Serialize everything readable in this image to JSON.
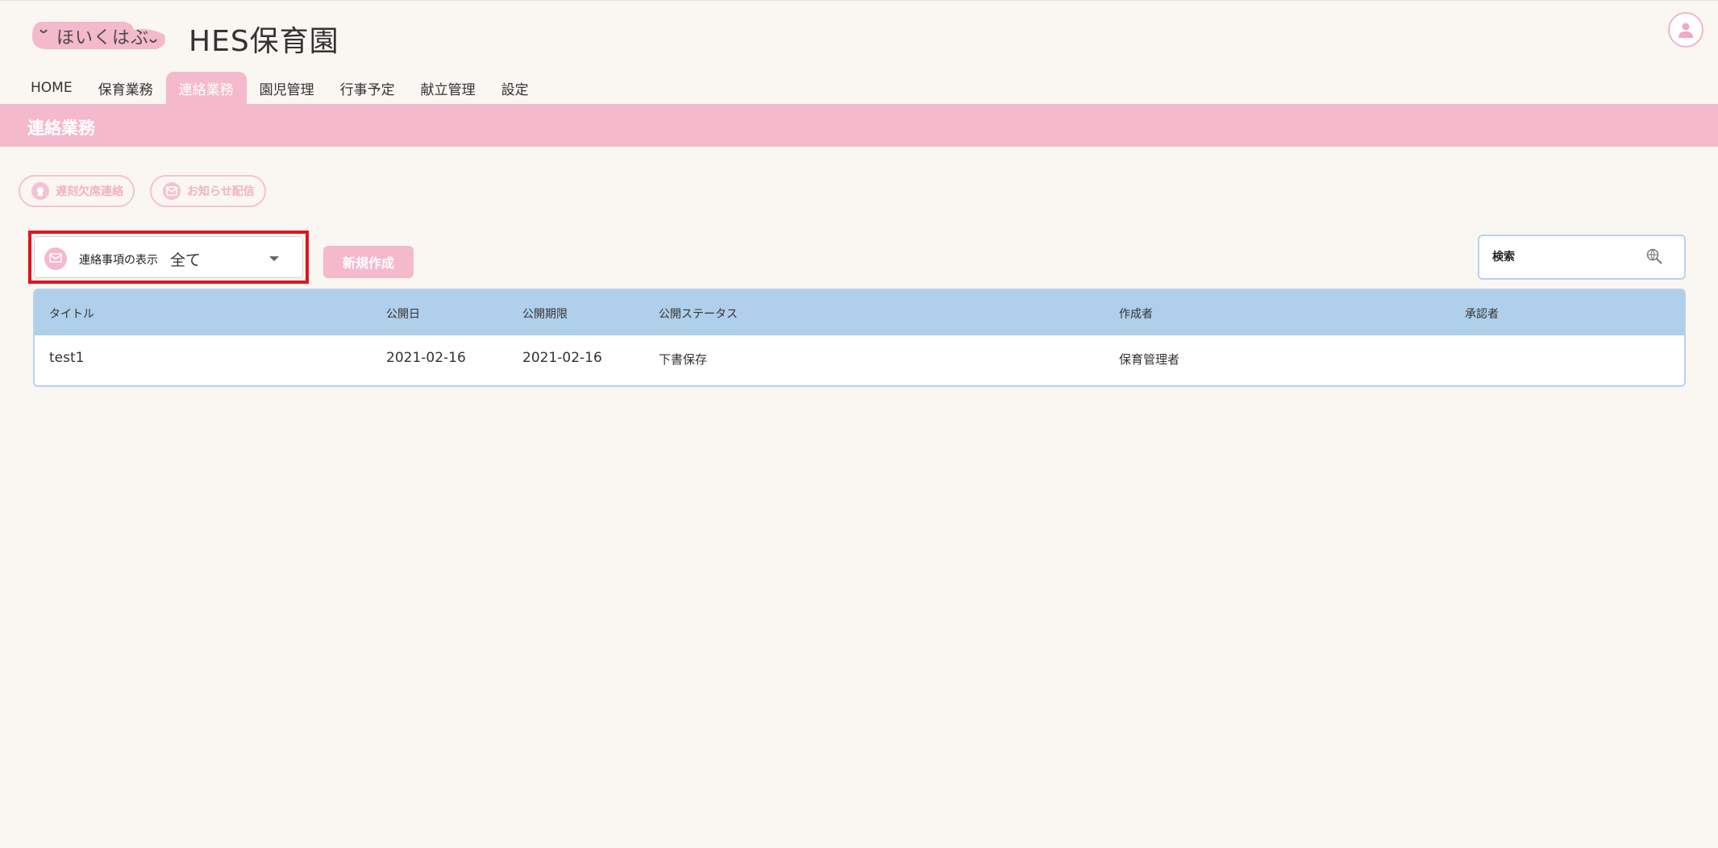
{
  "header": {
    "logo_text": "ほいくはぶ",
    "org_name": "HES保育園"
  },
  "nav": {
    "tabs": [
      {
        "label": "HOME",
        "active": false
      },
      {
        "label": "保育業務",
        "active": false
      },
      {
        "label": "連絡業務",
        "active": true
      },
      {
        "label": "園児管理",
        "active": false
      },
      {
        "label": "行事予定",
        "active": false
      },
      {
        "label": "献立管理",
        "active": false
      },
      {
        "label": "設定",
        "active": false
      }
    ]
  },
  "page": {
    "title": "連絡業務"
  },
  "sub_buttons": {
    "attendance_label": "遅刻欠席連絡",
    "notice_label": "お知らせ配信"
  },
  "filter": {
    "label": "連絡事項の表示",
    "value": "全て"
  },
  "actions": {
    "new_label": "新規作成"
  },
  "search": {
    "placeholder": "検索"
  },
  "table": {
    "columns": [
      "タイトル",
      "公開日",
      "公開期限",
      "公開ステータス",
      "作成者",
      "承認者"
    ],
    "rows": [
      {
        "title": "test1",
        "publish_date": "2021-02-16",
        "publish_deadline": "2021-02-16",
        "status": "下書保存",
        "author": "保育管理者",
        "approver": ""
      }
    ]
  },
  "colors": {
    "accent_pink": "#f4b9cb",
    "table_header_blue": "#afcfea",
    "highlight_red": "#e0141e",
    "background": "#faf6f2"
  }
}
